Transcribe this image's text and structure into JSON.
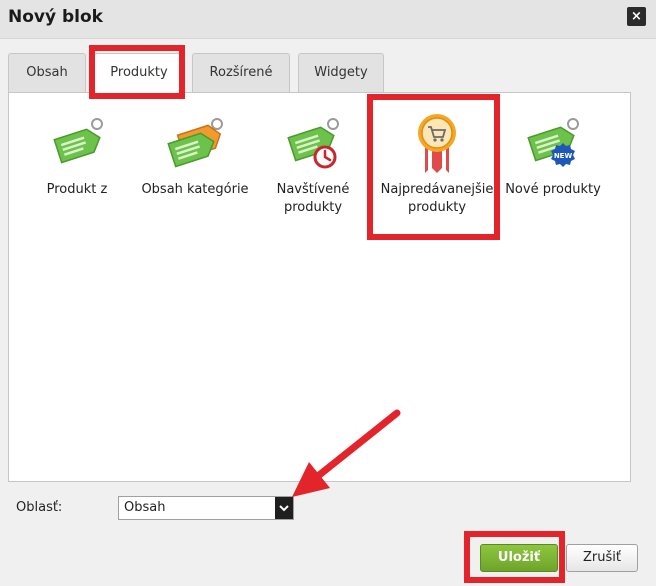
{
  "dialog": {
    "title": "Nový blok",
    "close_label": "×"
  },
  "tabs": [
    {
      "label": "Obsah"
    },
    {
      "label": "Produkty"
    },
    {
      "label": "Rozšírené"
    },
    {
      "label": "Widgety"
    }
  ],
  "items": [
    {
      "label": "Produkt z",
      "icon": "tag-icon"
    },
    {
      "label": "Obsah kategórie",
      "icon": "double-tag-icon"
    },
    {
      "label": "Navštívené produkty",
      "icon": "tag-clock-icon"
    },
    {
      "label": "Najpredávanejšie produkty",
      "icon": "ribbon-cart-icon"
    },
    {
      "label": "Nové produkty",
      "icon": "tag-new-icon"
    }
  ],
  "new_badge": "NEW",
  "area": {
    "label": "Oblasť:",
    "value": "Obsah"
  },
  "buttons": {
    "save": "Uložiť",
    "cancel": "Zrušiť"
  },
  "colors": {
    "highlight": "#e3242b",
    "save": "#7bb534",
    "tag_green": "#6cc24a",
    "tag_orange": "#f39a2e"
  }
}
